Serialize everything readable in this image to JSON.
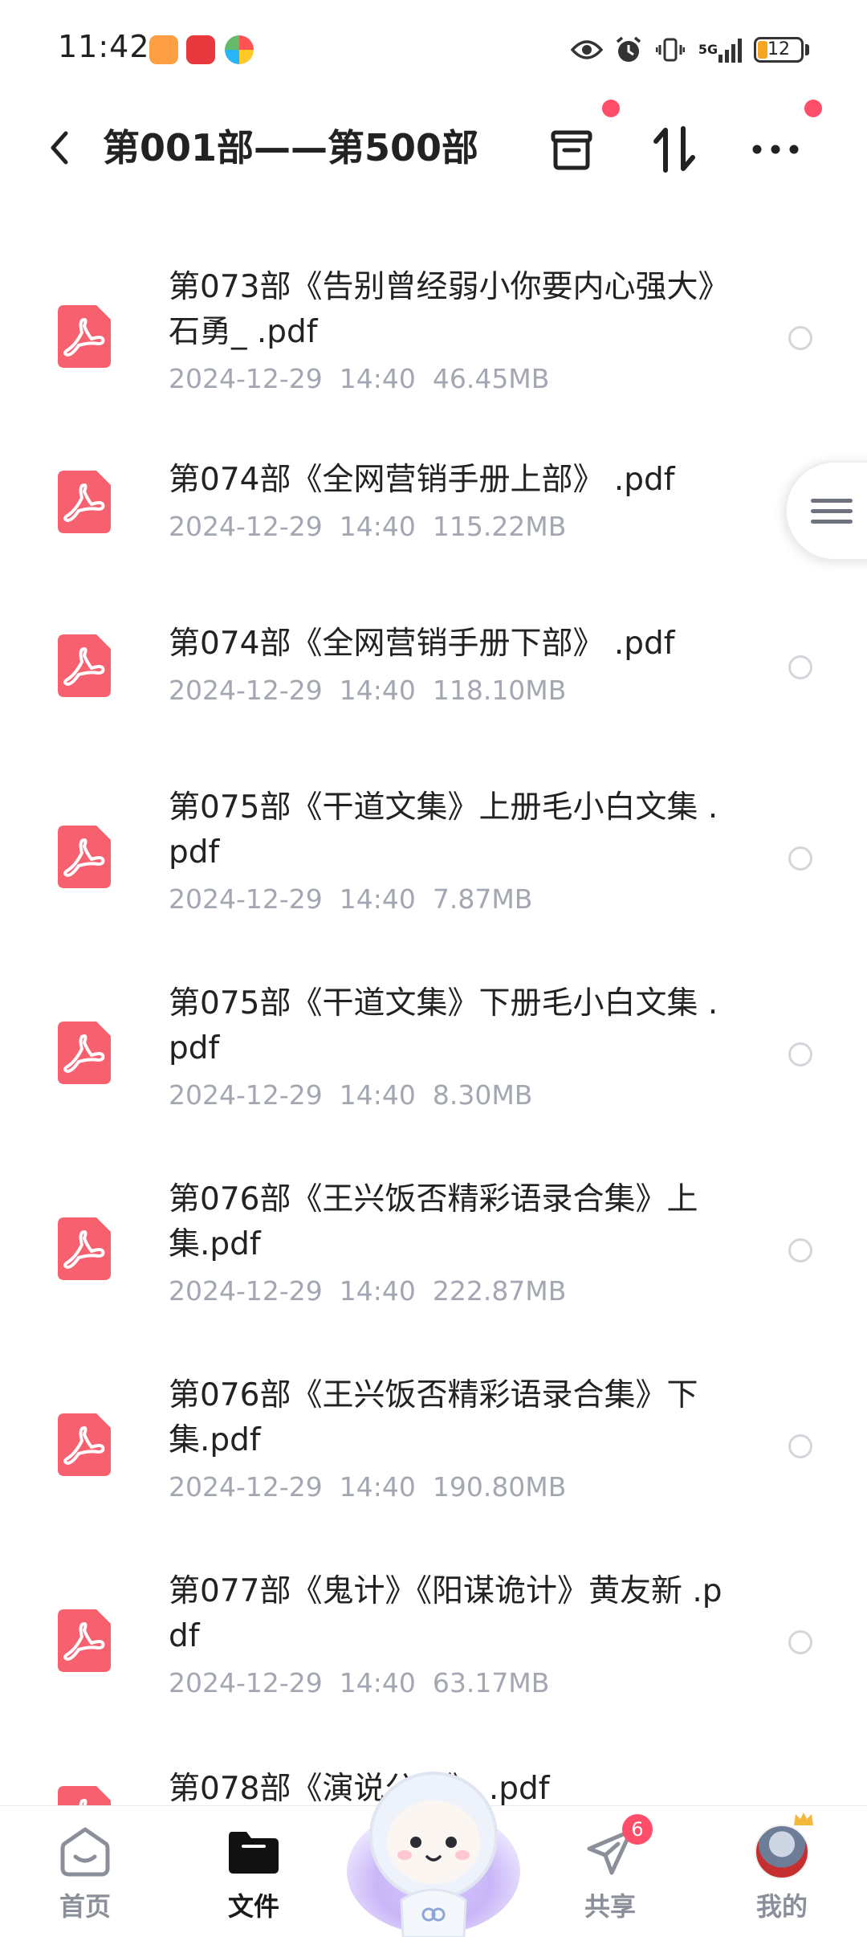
{
  "status_bar": {
    "time": "11:42",
    "network": "5G",
    "battery": "12"
  },
  "header": {
    "title": "第001部——第500部"
  },
  "files": [
    {
      "name": "第073部《告别曾经弱小你要内心强大》石勇_ .pdf",
      "meta": "2024-12-29  14:40  46.45MB"
    },
    {
      "name": "第074部《全网营销手册上部》 .pdf",
      "meta": "2024-12-29  14:40  115.22MB"
    },
    {
      "name": "第074部《全网营销手册下部》 .pdf",
      "meta": "2024-12-29  14:40  118.10MB"
    },
    {
      "name": "第075部《干道文集》上册毛小白文集 .pdf",
      "meta": "2024-12-29  14:40  7.87MB"
    },
    {
      "name": "第075部《干道文集》下册毛小白文集 .pdf",
      "meta": "2024-12-29  14:40  8.30MB"
    },
    {
      "name": "第076部《王兴饭否精彩语录合集》上集.pdf",
      "meta": "2024-12-29  14:40  222.87MB"
    },
    {
      "name": "第076部《王兴饭否精彩语录合集》下集.pdf",
      "meta": "2024-12-29  14:40  190.80MB"
    },
    {
      "name": "第077部《鬼计》《阳谋诡计》黄友新 .pdf",
      "meta": "2024-12-29  14:40  63.17MB"
    },
    {
      "name": "第078部《演说公式》 .pdf",
      "meta": ""
    }
  ],
  "bottom_nav": {
    "home": "首页",
    "files": "文件",
    "share": "共享",
    "share_badge": "6",
    "mine": "我的"
  },
  "colors": {
    "accent": "#ff4d6a",
    "pdf_icon": "#f7606e",
    "meta_text": "#a3a7b1"
  }
}
